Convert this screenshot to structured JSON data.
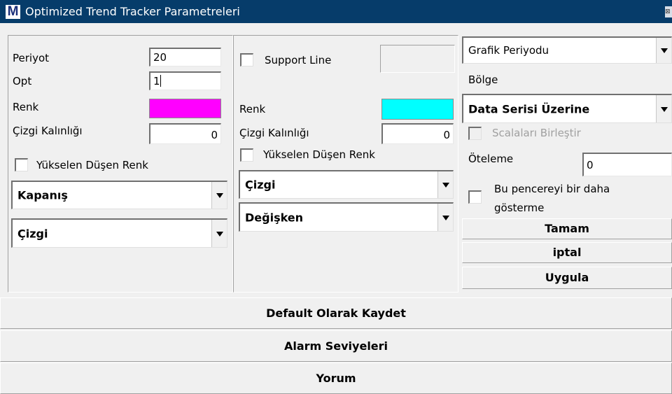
{
  "window": {
    "logo": "M",
    "title": "Optimized Trend Tracker Parametreleri",
    "close_glyph": "⊠"
  },
  "panel1": {
    "periyot_label": "Periyot",
    "periyot_value": "20",
    "opt_label": "Opt",
    "opt_value": "1",
    "renk_label": "Renk",
    "renk_color": "#ff00ff",
    "kalinlik_label": "Çizgi Kalınlığı",
    "kalinlik_value": "0",
    "yukselen_label": "Yükselen Düşen Renk",
    "source_combo": "Kapanış",
    "style_combo": "Çizgi"
  },
  "panel2": {
    "support_label": "Support Line",
    "renk_label": "Renk",
    "renk_color": "#00ffff",
    "kalinlik_label": "Çizgi Kalınlığı",
    "kalinlik_value": "0",
    "yukselen_label": "Yükselen Düşen Renk",
    "style_combo": "Çizgi",
    "type_combo": "Değişken"
  },
  "right": {
    "period_combo": "Grafik Periyodu",
    "bolge_label": "Bölge",
    "bolge_combo": "Data Serisi Üzerine",
    "scala_label": "Scalaları Birleştir",
    "oteleme_label": "Öteleme",
    "oteleme_value": "0",
    "show_again_label_line1": "Bu pencereyi bir daha",
    "show_again_label_line2": "gösterme",
    "tamam_label": "Tamam",
    "iptal_label": "iptal",
    "uygula_label": "Uygula"
  },
  "bottom": {
    "default_label": "Default Olarak Kaydet",
    "alarm_label": "Alarm Seviyeleri",
    "yorum_label": "Yorum"
  },
  "icons": {
    "dropdown": "chevron-down-icon",
    "checkbox": "checkbox-icon"
  }
}
